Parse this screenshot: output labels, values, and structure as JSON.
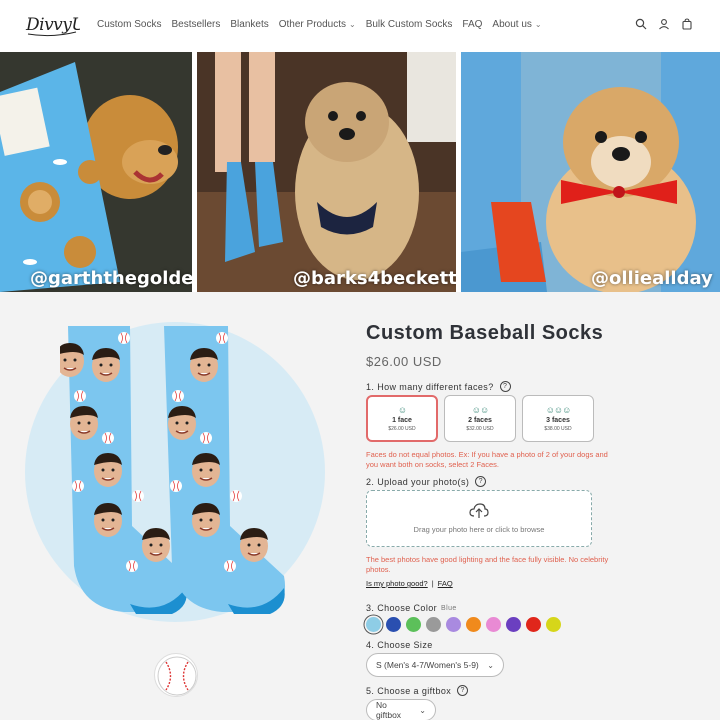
{
  "brand": {
    "logo_text": "DivvyUp"
  },
  "nav": {
    "items": [
      {
        "label": "Custom Socks",
        "has_dropdown": false
      },
      {
        "label": "Bestsellers",
        "has_dropdown": false
      },
      {
        "label": "Blankets",
        "has_dropdown": false
      },
      {
        "label": "Other Products",
        "has_dropdown": true
      },
      {
        "label": "Bulk Custom Socks",
        "has_dropdown": false
      },
      {
        "label": "FAQ",
        "has_dropdown": false
      },
      {
        "label": "About us",
        "has_dropdown": true
      }
    ],
    "icons": [
      "search-icon",
      "account-icon",
      "cart-icon"
    ]
  },
  "photos": [
    {
      "caption": "@garththegolden"
    },
    {
      "caption": "@barks4beckett"
    },
    {
      "caption": "@ollieallday"
    }
  ],
  "product": {
    "title": "Custom Baseball Socks",
    "price": "$26.00 USD",
    "faces_label": "1. How many different faces?",
    "faces": [
      {
        "emoji": "☺",
        "name": "1 face",
        "price": "$26.00 USD",
        "selected": true
      },
      {
        "emoji": "☺☺",
        "name": "2 faces",
        "price": "$32.00 USD",
        "selected": false
      },
      {
        "emoji": "☺☺☺",
        "name": "3 faces",
        "price": "$38.00 USD",
        "selected": false
      }
    ],
    "faces_note": "Faces do not equal photos. Ex: If you have a photo of 2 of your dogs and you want both on socks, select 2 Faces.",
    "upload_label": "2. Upload your photo(s)",
    "upload_text": "Drag your photo here or click to browse",
    "upload_note": "The best photos have good lighting and the face fully visible. No celebrity photos.",
    "link_photo_ok": "Is my photo good?",
    "link_separator": "|",
    "link_faq": "FAQ",
    "color_label": "3. Choose Color",
    "color_selected": "Blue",
    "colors": [
      "#8ecde6",
      "#2a4fb0",
      "#5cc05a",
      "#9a9a9a",
      "#a98ae0",
      "#f08a1c",
      "#e98ad4",
      "#6b3fc0",
      "#e0261b",
      "#d6d61a"
    ],
    "size_label": "4. Choose Size",
    "size_value": "S (Men's 4-7/Women's 5-9)",
    "giftbox_label": "5. Choose a giftbox",
    "giftbox_value": "No giftbox"
  },
  "theme": {
    "accent": "#e26a6a",
    "note_color": "#e0614f",
    "sock_blue": "#7cc6ef"
  }
}
